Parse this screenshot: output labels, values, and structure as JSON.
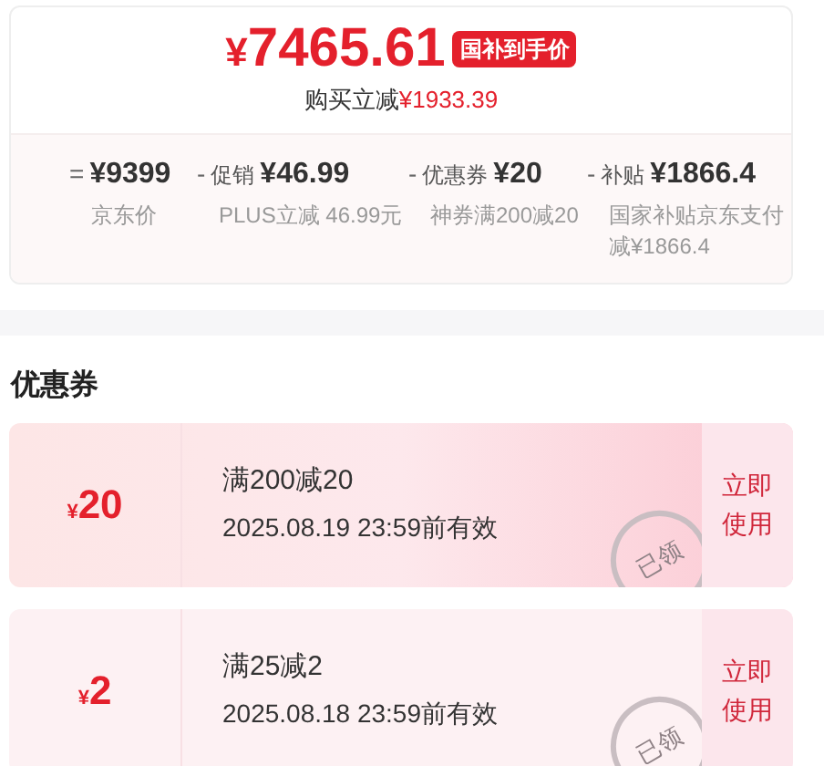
{
  "price": {
    "currency": "¥",
    "amount": "7465.61",
    "badge": "国补到手价",
    "saving_label": "购买立减",
    "saving_value": "¥1933.39"
  },
  "breakdown": [
    {
      "op": "=",
      "value": "¥9399",
      "note": "京东价"
    },
    {
      "op": "-",
      "label": "促销",
      "value": "¥46.99",
      "note": "PLUS立减 46.99元"
    },
    {
      "op": "-",
      "label": "优惠券",
      "value": "¥20",
      "note": "神券满200减20"
    },
    {
      "op": "-",
      "label": "补贴",
      "value": "¥1866.4",
      "note": "国家补贴京东支付减¥1866.4"
    }
  ],
  "coupons_title": "优惠券",
  "coupons": [
    {
      "currency": "¥",
      "amount": "20",
      "condition": "满200减20",
      "validity": "2025.08.19 23:59前有效",
      "stamp": "已领",
      "action": "立即使用",
      "highlighted": true
    },
    {
      "currency": "¥",
      "amount": "2",
      "condition": "满25减2",
      "validity": "2025.08.18 23:59前有效",
      "stamp": "已领",
      "action": "立即使用",
      "highlighted": false
    }
  ]
}
